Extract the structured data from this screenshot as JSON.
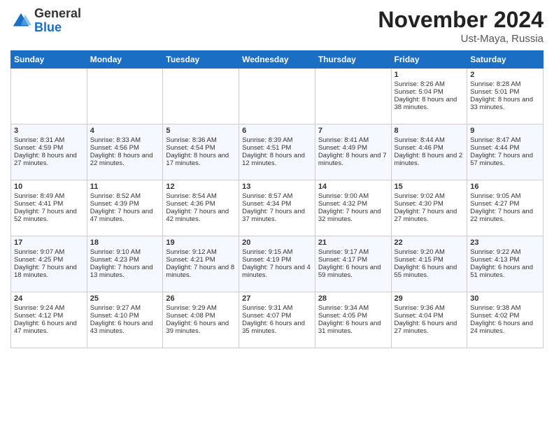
{
  "logo": {
    "general": "General",
    "blue": "Blue"
  },
  "header": {
    "month": "November 2024",
    "location": "Ust-Maya, Russia"
  },
  "days_of_week": [
    "Sunday",
    "Monday",
    "Tuesday",
    "Wednesday",
    "Thursday",
    "Friday",
    "Saturday"
  ],
  "weeks": [
    [
      {
        "day": "",
        "sunrise": "",
        "sunset": "",
        "daylight": ""
      },
      {
        "day": "",
        "sunrise": "",
        "sunset": "",
        "daylight": ""
      },
      {
        "day": "",
        "sunrise": "",
        "sunset": "",
        "daylight": ""
      },
      {
        "day": "",
        "sunrise": "",
        "sunset": "",
        "daylight": ""
      },
      {
        "day": "",
        "sunrise": "",
        "sunset": "",
        "daylight": ""
      },
      {
        "day": "1",
        "sunrise": "Sunrise: 8:26 AM",
        "sunset": "Sunset: 5:04 PM",
        "daylight": "Daylight: 8 hours and 38 minutes."
      },
      {
        "day": "2",
        "sunrise": "Sunrise: 8:28 AM",
        "sunset": "Sunset: 5:01 PM",
        "daylight": "Daylight: 8 hours and 33 minutes."
      }
    ],
    [
      {
        "day": "3",
        "sunrise": "Sunrise: 8:31 AM",
        "sunset": "Sunset: 4:59 PM",
        "daylight": "Daylight: 8 hours and 27 minutes."
      },
      {
        "day": "4",
        "sunrise": "Sunrise: 8:33 AM",
        "sunset": "Sunset: 4:56 PM",
        "daylight": "Daylight: 8 hours and 22 minutes."
      },
      {
        "day": "5",
        "sunrise": "Sunrise: 8:36 AM",
        "sunset": "Sunset: 4:54 PM",
        "daylight": "Daylight: 8 hours and 17 minutes."
      },
      {
        "day": "6",
        "sunrise": "Sunrise: 8:39 AM",
        "sunset": "Sunset: 4:51 PM",
        "daylight": "Daylight: 8 hours and 12 minutes."
      },
      {
        "day": "7",
        "sunrise": "Sunrise: 8:41 AM",
        "sunset": "Sunset: 4:49 PM",
        "daylight": "Daylight: 8 hours and 7 minutes."
      },
      {
        "day": "8",
        "sunrise": "Sunrise: 8:44 AM",
        "sunset": "Sunset: 4:46 PM",
        "daylight": "Daylight: 8 hours and 2 minutes."
      },
      {
        "day": "9",
        "sunrise": "Sunrise: 8:47 AM",
        "sunset": "Sunset: 4:44 PM",
        "daylight": "Daylight: 7 hours and 57 minutes."
      }
    ],
    [
      {
        "day": "10",
        "sunrise": "Sunrise: 8:49 AM",
        "sunset": "Sunset: 4:41 PM",
        "daylight": "Daylight: 7 hours and 52 minutes."
      },
      {
        "day": "11",
        "sunrise": "Sunrise: 8:52 AM",
        "sunset": "Sunset: 4:39 PM",
        "daylight": "Daylight: 7 hours and 47 minutes."
      },
      {
        "day": "12",
        "sunrise": "Sunrise: 8:54 AM",
        "sunset": "Sunset: 4:36 PM",
        "daylight": "Daylight: 7 hours and 42 minutes."
      },
      {
        "day": "13",
        "sunrise": "Sunrise: 8:57 AM",
        "sunset": "Sunset: 4:34 PM",
        "daylight": "Daylight: 7 hours and 37 minutes."
      },
      {
        "day": "14",
        "sunrise": "Sunrise: 9:00 AM",
        "sunset": "Sunset: 4:32 PM",
        "daylight": "Daylight: 7 hours and 32 minutes."
      },
      {
        "day": "15",
        "sunrise": "Sunrise: 9:02 AM",
        "sunset": "Sunset: 4:30 PM",
        "daylight": "Daylight: 7 hours and 27 minutes."
      },
      {
        "day": "16",
        "sunrise": "Sunrise: 9:05 AM",
        "sunset": "Sunset: 4:27 PM",
        "daylight": "Daylight: 7 hours and 22 minutes."
      }
    ],
    [
      {
        "day": "17",
        "sunrise": "Sunrise: 9:07 AM",
        "sunset": "Sunset: 4:25 PM",
        "daylight": "Daylight: 7 hours and 18 minutes."
      },
      {
        "day": "18",
        "sunrise": "Sunrise: 9:10 AM",
        "sunset": "Sunset: 4:23 PM",
        "daylight": "Daylight: 7 hours and 13 minutes."
      },
      {
        "day": "19",
        "sunrise": "Sunrise: 9:12 AM",
        "sunset": "Sunset: 4:21 PM",
        "daylight": "Daylight: 7 hours and 8 minutes."
      },
      {
        "day": "20",
        "sunrise": "Sunrise: 9:15 AM",
        "sunset": "Sunset: 4:19 PM",
        "daylight": "Daylight: 7 hours and 4 minutes."
      },
      {
        "day": "21",
        "sunrise": "Sunrise: 9:17 AM",
        "sunset": "Sunset: 4:17 PM",
        "daylight": "Daylight: 6 hours and 59 minutes."
      },
      {
        "day": "22",
        "sunrise": "Sunrise: 9:20 AM",
        "sunset": "Sunset: 4:15 PM",
        "daylight": "Daylight: 6 hours and 55 minutes."
      },
      {
        "day": "23",
        "sunrise": "Sunrise: 9:22 AM",
        "sunset": "Sunset: 4:13 PM",
        "daylight": "Daylight: 6 hours and 51 minutes."
      }
    ],
    [
      {
        "day": "24",
        "sunrise": "Sunrise: 9:24 AM",
        "sunset": "Sunset: 4:12 PM",
        "daylight": "Daylight: 6 hours and 47 minutes."
      },
      {
        "day": "25",
        "sunrise": "Sunrise: 9:27 AM",
        "sunset": "Sunset: 4:10 PM",
        "daylight": "Daylight: 6 hours and 43 minutes."
      },
      {
        "day": "26",
        "sunrise": "Sunrise: 9:29 AM",
        "sunset": "Sunset: 4:08 PM",
        "daylight": "Daylight: 6 hours and 39 minutes."
      },
      {
        "day": "27",
        "sunrise": "Sunrise: 9:31 AM",
        "sunset": "Sunset: 4:07 PM",
        "daylight": "Daylight: 6 hours and 35 minutes."
      },
      {
        "day": "28",
        "sunrise": "Sunrise: 9:34 AM",
        "sunset": "Sunset: 4:05 PM",
        "daylight": "Daylight: 6 hours and 31 minutes."
      },
      {
        "day": "29",
        "sunrise": "Sunrise: 9:36 AM",
        "sunset": "Sunset: 4:04 PM",
        "daylight": "Daylight: 6 hours and 27 minutes."
      },
      {
        "day": "30",
        "sunrise": "Sunrise: 9:38 AM",
        "sunset": "Sunset: 4:02 PM",
        "daylight": "Daylight: 6 hours and 24 minutes."
      }
    ]
  ]
}
